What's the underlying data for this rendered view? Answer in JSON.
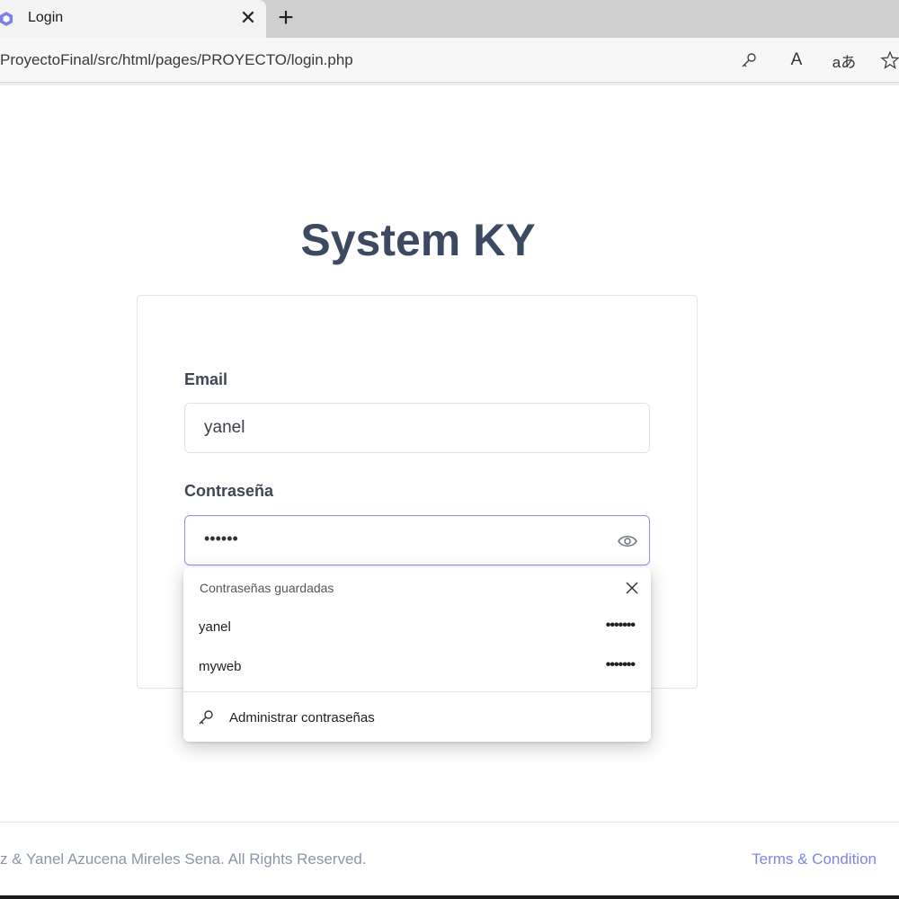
{
  "browser": {
    "tab_title": "Login",
    "tab_close": "✕",
    "new_tab": "+",
    "url": "ProyectoFinal/src/html/pages/PROYECTO/login.php",
    "icons": [
      "key-icon",
      "read-aloud-icon",
      "translate-icon",
      "favorite-star-icon"
    ],
    "read_aloud_label": "A",
    "translate_label": "aあ"
  },
  "page": {
    "brand": "System KY",
    "email_label": "Email",
    "email_value": "yanel",
    "password_label": "Contraseña",
    "password_value": "••••••"
  },
  "autofill": {
    "title": "Contraseñas guardadas",
    "entries": [
      {
        "user": "yanel",
        "masked": "•••••••"
      },
      {
        "user": "myweb",
        "masked": "•••••••"
      }
    ],
    "manage_label": "Administrar contraseñas"
  },
  "footer": {
    "copyright": "z & Yanel Azucena Mireles Sena. All Rights Reserved.",
    "terms": "Terms & Condition"
  },
  "colors": {
    "brand": "#3b4a61",
    "accent": "#7c86e6",
    "focus_border": "#8b8ff0"
  }
}
